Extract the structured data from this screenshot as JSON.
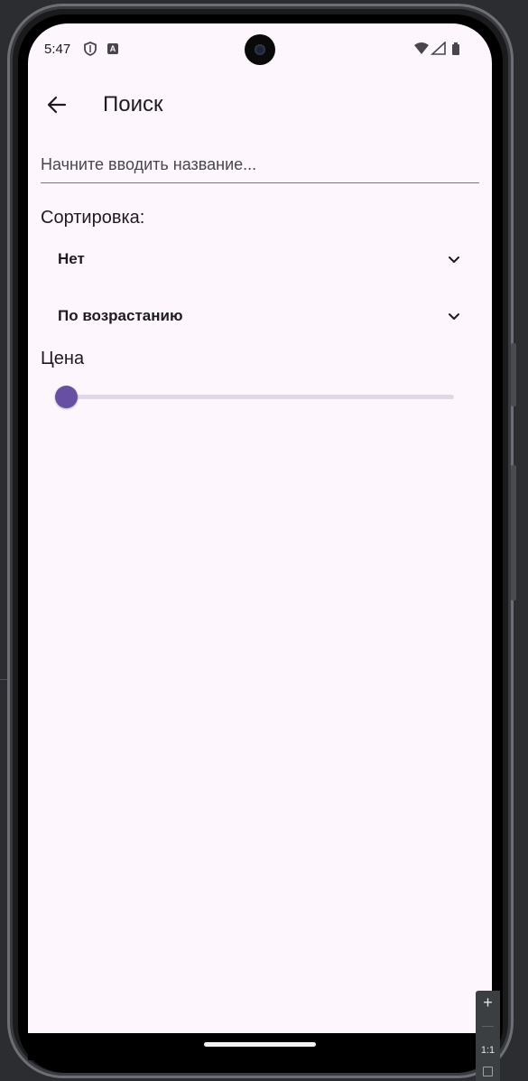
{
  "status_bar": {
    "time": "5:47",
    "a_badge": "A"
  },
  "app_bar": {
    "title": "Поиск"
  },
  "search": {
    "placeholder": "Начните вводить название...",
    "value": ""
  },
  "sort": {
    "label": "Сортировка:",
    "field_value": "Нет",
    "order_value": "По возрастанию"
  },
  "price": {
    "label": "Цена",
    "slider_fraction": 0
  },
  "zoom": {
    "plus": "+",
    "minus": "—",
    "ratio": "1:1"
  },
  "colors": {
    "background": "#fdf7fd",
    "accent": "#6750a4",
    "track": "#e0d7e7",
    "text": "#1d1b20"
  },
  "icons": {
    "back": "arrow-left",
    "chevron": "chevron-down",
    "shield": "shield-outline",
    "wifi": "wifi",
    "signal": "cell-signal",
    "battery": "battery"
  }
}
